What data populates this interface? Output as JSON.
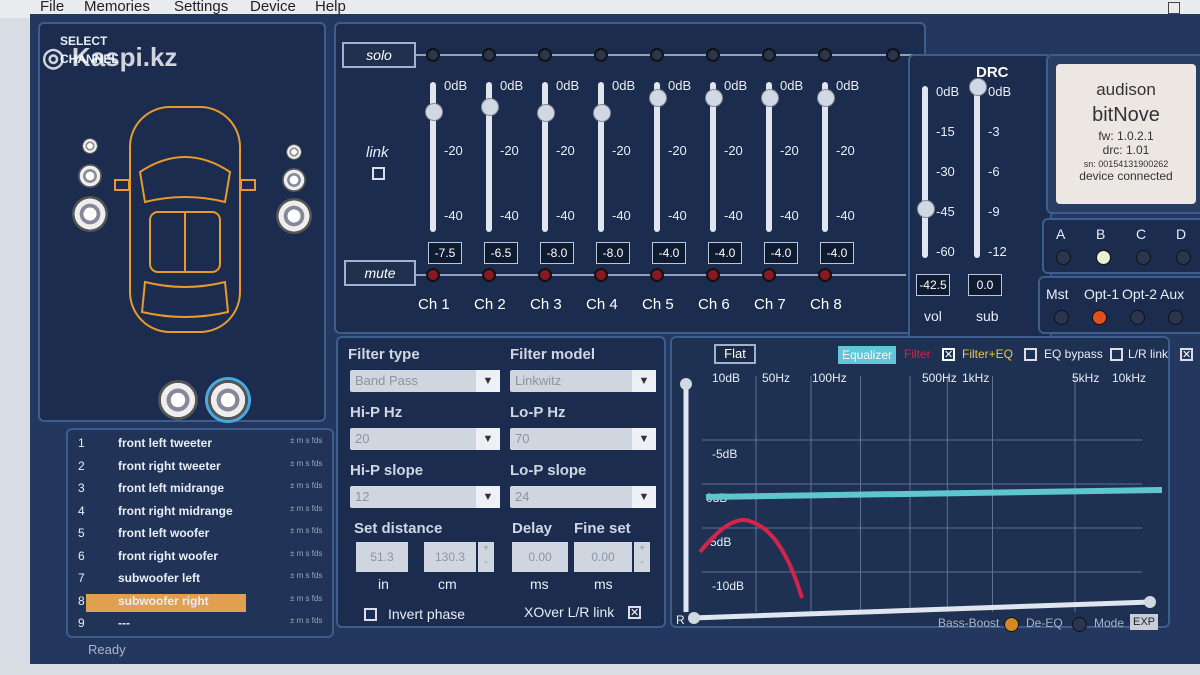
{
  "menu": {
    "file": "File",
    "memories": "Memories",
    "settings": "Settings",
    "device": "Device",
    "help": "Help"
  },
  "watermark": "Kaspi.kz",
  "select_channel": "SELECT CHANNEL",
  "mixer": {
    "solo": "solo",
    "mute": "mute",
    "link": "link",
    "ticks": [
      "0dB",
      "-20",
      "-40"
    ],
    "channels": [
      {
        "name": "Ch 1",
        "value": "-7.5",
        "level": 0.19
      },
      {
        "name": "Ch 2",
        "value": "-6.5",
        "level": 0.16
      },
      {
        "name": "Ch 3",
        "value": "-8.0",
        "level": 0.2
      },
      {
        "name": "Ch 4",
        "value": "-8.0",
        "level": 0.2
      },
      {
        "name": "Ch 5",
        "value": "-4.0",
        "level": 0.1
      },
      {
        "name": "Ch 6",
        "value": "-4.0",
        "level": 0.1
      },
      {
        "name": "Ch 7",
        "value": "-4.0",
        "level": 0.1
      },
      {
        "name": "Ch 8",
        "value": "-4.0",
        "level": 0.1
      }
    ]
  },
  "drc": {
    "title": "DRC",
    "vol_ticks": [
      "0dB",
      "-15",
      "-30",
      "-45",
      "-60"
    ],
    "sub_ticks": [
      "0dB",
      "-3",
      "-6",
      "-9",
      "-12"
    ],
    "vol_value": "-42.5",
    "sub_value": "0.0",
    "vol_label": "vol",
    "sub_label": "sub",
    "vol_level": 0.71,
    "sub_level": 0.0
  },
  "device": {
    "brand": "audison",
    "model": "bitNove",
    "fw": "fw: 1.0.2.1",
    "drc": "drc: 1.01",
    "sn": "sn: 00154131900262",
    "status": "device connected"
  },
  "memories": [
    "A",
    "B",
    "C",
    "D"
  ],
  "inputs": [
    "Mst",
    "Opt-1",
    "Opt-2",
    "Aux"
  ],
  "filter": {
    "filter_type_label": "Filter type",
    "filter_type": "Band Pass",
    "filter_model_label": "Filter model",
    "filter_model": "Linkwitz",
    "hip_label": "Hi-P Hz",
    "hip": "20",
    "lop_label": "Lo-P Hz",
    "lop": "70",
    "hip_slope_label": "Hi-P slope",
    "hip_slope": "12",
    "lop_slope_label": "Lo-P slope",
    "lop_slope": "24",
    "distance_label": "Set distance",
    "dist_in": "51.3",
    "dist_cm": "130.3",
    "in_label": "in",
    "cm_label": "cm",
    "delay_label": "Delay",
    "delay": "0.00",
    "fine_label": "Fine set",
    "fine": "0.00",
    "ms1": "ms",
    "ms2": "ms",
    "invert": "Invert phase",
    "xover": "XOver L/R link"
  },
  "eq": {
    "flat": "Flat",
    "equalizer": "Equalizer",
    "filter": "Filter",
    "filter_eq": "Filter+EQ",
    "eq_bypass": "EQ bypass",
    "lr_link": "L/R link",
    "freq_labels": [
      "10dB",
      "50Hz",
      "100Hz",
      "500Hz",
      "1kHz",
      "5kHz",
      "10kHz"
    ],
    "db_labels": [
      "-5dB",
      "0dB",
      "-5dB",
      "-10dB"
    ],
    "r_label": "R",
    "bass_boost": "Bass-Boost",
    "de_eq": "De-EQ",
    "mode": "Mode",
    "exp": "EXP"
  },
  "channel_list": [
    {
      "n": "1",
      "name": "front left tweeter"
    },
    {
      "n": "2",
      "name": "front right tweeter"
    },
    {
      "n": "3",
      "name": "front left midrange"
    },
    {
      "n": "4",
      "name": "front right midrange"
    },
    {
      "n": "5",
      "name": "front left woofer"
    },
    {
      "n": "6",
      "name": "front right woofer"
    },
    {
      "n": "7",
      "name": "subwoofer left"
    },
    {
      "n": "8",
      "name": "subwoofer right"
    },
    {
      "n": "9",
      "name": "---"
    }
  ],
  "row_marks": "± m s fds",
  "status": "Ready"
}
